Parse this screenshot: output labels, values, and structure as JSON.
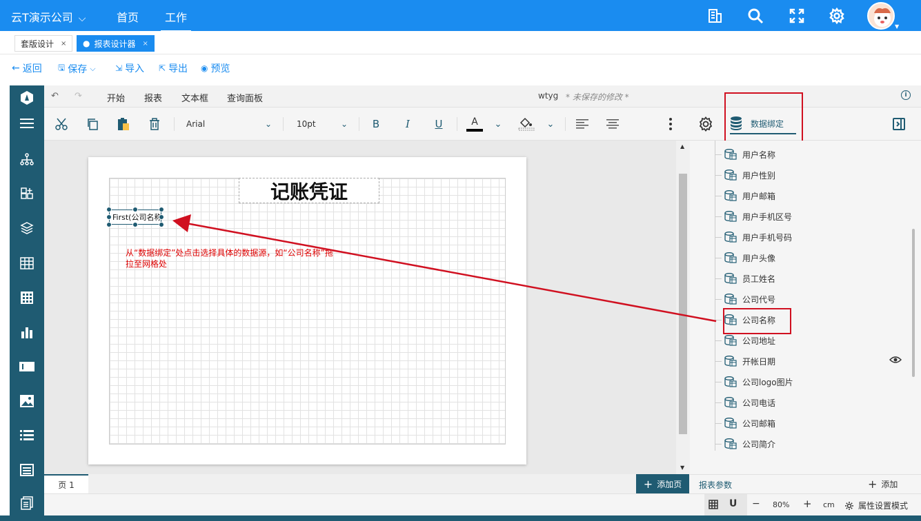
{
  "topbar": {
    "company": "云T演示公司",
    "nav": [
      "首页",
      "工作"
    ]
  },
  "tabs": [
    {
      "label": "套版设计",
      "close": "×"
    },
    {
      "label": "报表设计器",
      "close": "×"
    }
  ],
  "actions": {
    "back": "返回",
    "save": "保存",
    "import": "导入",
    "export": "导出",
    "preview": "预览"
  },
  "ribbon_tabs": [
    "开始",
    "报表",
    "文本框",
    "查询面板"
  ],
  "doc": {
    "name": "wtyg",
    "unsaved": "* 未保存的修改 *"
  },
  "toolbar": {
    "font": "Arial",
    "size": "10pt",
    "bold": "B",
    "italic": "I",
    "underline": "U",
    "font_color_letter": "A",
    "data_binding": "数据绑定"
  },
  "canvas": {
    "title": "记账凭证",
    "cell_text": "First(公司名称)",
    "annotation": "从“数据绑定”处点击选择具体的数据源，如“公司名称”拖拉至网格处"
  },
  "fields": [
    "用户名称",
    "用户性别",
    "用户邮箱",
    "用户手机区号",
    "用户手机号码",
    "用户头像",
    "员工姓名",
    "公司代号",
    "公司名称",
    "公司地址",
    "开帐日期",
    "公司logo图片",
    "公司电话",
    "公司邮箱",
    "公司简介"
  ],
  "params": {
    "label": "报表参数",
    "add": "添加"
  },
  "page": {
    "tab": "页 1",
    "add": "添加页"
  },
  "status": {
    "minus": "−",
    "zoom": "80%",
    "plus": "+",
    "unit": "cm",
    "prop_mode": "属性设置模式"
  },
  "colors": {
    "brand_blue": "#1a8cf0",
    "teal": "#1f5b72",
    "highlight_red": "#d01020"
  }
}
